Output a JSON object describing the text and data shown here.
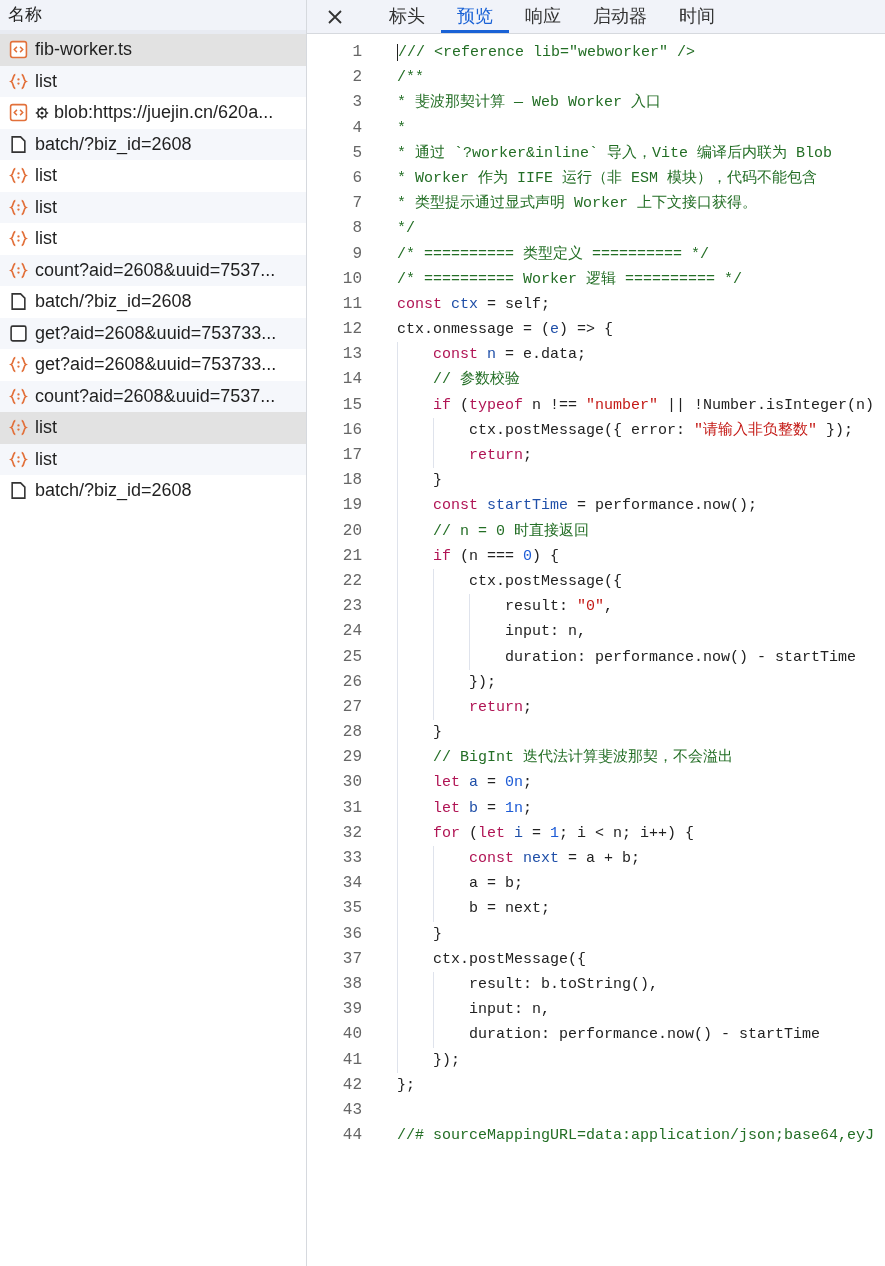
{
  "requests": {
    "header": "名称",
    "rows": [
      {
        "kind": "script",
        "name": "fib-worker.ts",
        "selected": true,
        "hovered": false
      },
      {
        "kind": "fetch",
        "name": "list",
        "selected": false,
        "hovered": false
      },
      {
        "kind": "script",
        "worker": true,
        "name": "blob:https://juejin.cn/620a...",
        "selected": false,
        "hovered": false
      },
      {
        "kind": "document",
        "name": "batch/?biz_id=2608",
        "selected": false,
        "hovered": false
      },
      {
        "kind": "fetch",
        "name": "list",
        "selected": false,
        "hovered": false
      },
      {
        "kind": "fetch",
        "name": "list",
        "selected": false,
        "hovered": false
      },
      {
        "kind": "fetch",
        "name": "list",
        "selected": false,
        "hovered": false
      },
      {
        "kind": "fetch",
        "name": "count?aid=2608&uuid=7537...",
        "selected": false,
        "hovered": false
      },
      {
        "kind": "document",
        "name": "batch/?biz_id=2608",
        "selected": false,
        "hovered": false
      },
      {
        "kind": "other",
        "name": "get?aid=2608&uuid=753733...",
        "selected": false,
        "hovered": false
      },
      {
        "kind": "fetch",
        "name": "get?aid=2608&uuid=753733...",
        "selected": false,
        "hovered": false
      },
      {
        "kind": "fetch",
        "name": "count?aid=2608&uuid=7537...",
        "selected": false,
        "hovered": false
      },
      {
        "kind": "fetch",
        "name": "list",
        "selected": true,
        "hovered": false
      },
      {
        "kind": "fetch",
        "name": "list",
        "selected": false,
        "hovered": false
      },
      {
        "kind": "document",
        "name": "batch/?biz_id=2608",
        "selected": false,
        "hovered": false
      }
    ]
  },
  "tabs": [
    {
      "label": "标头",
      "selected": false
    },
    {
      "label": "预览",
      "selected": true
    },
    {
      "label": "响应",
      "selected": false
    },
    {
      "label": "启动器",
      "selected": false
    },
    {
      "label": "时间",
      "selected": false
    }
  ],
  "code": [
    {
      "number": "1",
      "tokens": [
        {
          "kind": "comment",
          "text": "/// <reference lib=\"webworker\" />"
        }
      ]
    },
    {
      "number": "2",
      "tokens": [
        {
          "kind": "comment",
          "text": "/**"
        }
      ]
    },
    {
      "number": "3",
      "tokens": [
        {
          "kind": "comment",
          "text": "* 斐波那契计算 — Web Worker 入口"
        }
      ]
    },
    {
      "number": "4",
      "tokens": [
        {
          "kind": "comment",
          "text": "*"
        }
      ]
    },
    {
      "number": "5",
      "tokens": [
        {
          "kind": "comment",
          "text": "* 通过 `?worker&inline` 导入，Vite 编译后内联为 Blob"
        }
      ]
    },
    {
      "number": "6",
      "tokens": [
        {
          "kind": "comment",
          "text": "* Worker 作为 IIFE 运行（非 ESM 模块），代码不能包含"
        }
      ]
    },
    {
      "number": "7",
      "tokens": [
        {
          "kind": "comment",
          "text": "* 类型提示通过显式声明 Worker 上下文接口获得。"
        }
      ]
    },
    {
      "number": "8",
      "tokens": [
        {
          "kind": "comment",
          "text": "*/"
        }
      ]
    },
    {
      "number": "9",
      "tokens": [
        {
          "kind": "comment",
          "text": "/* ========== 类型定义 ========== */"
        }
      ]
    },
    {
      "number": "10",
      "tokens": [
        {
          "kind": "comment",
          "text": "/* ========== Worker 逻辑 ========== */"
        }
      ]
    },
    {
      "number": "11",
      "tokens": [
        {
          "kind": "keyword",
          "text": "const"
        },
        {
          "kind": "variable",
          "text": " ctx"
        },
        {
          "kind": "plain",
          "text": " = self;"
        }
      ]
    },
    {
      "number": "12",
      "tokens": [
        {
          "kind": "plain",
          "text": "ctx.onmessage = ("
        },
        {
          "kind": "variable",
          "text": "e"
        },
        {
          "kind": "plain",
          "text": ") => {"
        }
      ]
    },
    {
      "number": "13",
      "tokens": [
        {
          "kind": "keyword",
          "text": "    const"
        },
        {
          "kind": "variable",
          "text": " n"
        },
        {
          "kind": "plain",
          "text": " = e.data;"
        }
      ]
    },
    {
      "number": "14",
      "tokens": [
        {
          "kind": "comment",
          "text": "    // 参数校验"
        }
      ]
    },
    {
      "number": "15",
      "tokens": [
        {
          "kind": "keyword",
          "text": "    if"
        },
        {
          "kind": "plain",
          "text": " ("
        },
        {
          "kind": "keyword",
          "text": "typeof"
        },
        {
          "kind": "plain",
          "text": " n !== "
        },
        {
          "kind": "string",
          "text": "\"number\""
        },
        {
          "kind": "plain",
          "text": " || !Number.isInteger(n)"
        }
      ]
    },
    {
      "number": "16",
      "tokens": [
        {
          "kind": "plain",
          "text": "        ctx.postMessage({ error: "
        },
        {
          "kind": "string",
          "text": "\"请输入非负整数\""
        },
        {
          "kind": "plain",
          "text": " });"
        }
      ]
    },
    {
      "number": "17",
      "tokens": [
        {
          "kind": "keyword",
          "text": "        return"
        },
        {
          "kind": "plain",
          "text": ";"
        }
      ]
    },
    {
      "number": "18",
      "tokens": [
        {
          "kind": "plain",
          "text": "    }"
        }
      ]
    },
    {
      "number": "19",
      "tokens": [
        {
          "kind": "keyword",
          "text": "    const"
        },
        {
          "kind": "variable",
          "text": " startTime"
        },
        {
          "kind": "plain",
          "text": " = performance.now();"
        }
      ]
    },
    {
      "number": "20",
      "tokens": [
        {
          "kind": "comment",
          "text": "    // n = 0 时直接返回"
        }
      ]
    },
    {
      "number": "21",
      "tokens": [
        {
          "kind": "keyword",
          "text": "    if"
        },
        {
          "kind": "plain",
          "text": " (n === "
        },
        {
          "kind": "number",
          "text": "0"
        },
        {
          "kind": "plain",
          "text": ") {"
        }
      ]
    },
    {
      "number": "22",
      "tokens": [
        {
          "kind": "plain",
          "text": "        ctx.postMessage({"
        }
      ]
    },
    {
      "number": "23",
      "tokens": [
        {
          "kind": "plain",
          "text": "            result: "
        },
        {
          "kind": "string",
          "text": "\"0\""
        },
        {
          "kind": "plain",
          "text": ","
        }
      ]
    },
    {
      "number": "24",
      "tokens": [
        {
          "kind": "plain",
          "text": "            input: n,"
        }
      ]
    },
    {
      "number": "25",
      "tokens": [
        {
          "kind": "plain",
          "text": "            duration: performance.now() - startTime"
        }
      ]
    },
    {
      "number": "26",
      "tokens": [
        {
          "kind": "plain",
          "text": "        });"
        }
      ]
    },
    {
      "number": "27",
      "tokens": [
        {
          "kind": "keyword",
          "text": "        return"
        },
        {
          "kind": "plain",
          "text": ";"
        }
      ]
    },
    {
      "number": "28",
      "tokens": [
        {
          "kind": "plain",
          "text": "    }"
        }
      ]
    },
    {
      "number": "29",
      "tokens": [
        {
          "kind": "comment",
          "text": "    // BigInt 迭代法计算斐波那契，不会溢出"
        }
      ]
    },
    {
      "number": "30",
      "tokens": [
        {
          "kind": "keyword",
          "text": "    let"
        },
        {
          "kind": "variable",
          "text": " a"
        },
        {
          "kind": "plain",
          "text": " = "
        },
        {
          "kind": "number",
          "text": "0n"
        },
        {
          "kind": "plain",
          "text": ";"
        }
      ]
    },
    {
      "number": "31",
      "tokens": [
        {
          "kind": "keyword",
          "text": "    let"
        },
        {
          "kind": "variable",
          "text": " b"
        },
        {
          "kind": "plain",
          "text": " = "
        },
        {
          "kind": "number",
          "text": "1n"
        },
        {
          "kind": "plain",
          "text": ";"
        }
      ]
    },
    {
      "number": "32",
      "tokens": [
        {
          "kind": "keyword",
          "text": "    for"
        },
        {
          "kind": "plain",
          "text": " ("
        },
        {
          "kind": "keyword",
          "text": "let"
        },
        {
          "kind": "variable",
          "text": " i"
        },
        {
          "kind": "plain",
          "text": " = "
        },
        {
          "kind": "number",
          "text": "1"
        },
        {
          "kind": "plain",
          "text": "; i < n; i++) {"
        }
      ]
    },
    {
      "number": "33",
      "tokens": [
        {
          "kind": "keyword",
          "text": "        const"
        },
        {
          "kind": "variable",
          "text": " next"
        },
        {
          "kind": "plain",
          "text": " = a + b;"
        }
      ]
    },
    {
      "number": "34",
      "tokens": [
        {
          "kind": "plain",
          "text": "        a = b;"
        }
      ]
    },
    {
      "number": "35",
      "tokens": [
        {
          "kind": "plain",
          "text": "        b = next;"
        }
      ]
    },
    {
      "number": "36",
      "tokens": [
        {
          "kind": "plain",
          "text": "    }"
        }
      ]
    },
    {
      "number": "37",
      "tokens": [
        {
          "kind": "plain",
          "text": "    ctx.postMessage({"
        }
      ]
    },
    {
      "number": "38",
      "tokens": [
        {
          "kind": "plain",
          "text": "        result: b.toString(),"
        }
      ]
    },
    {
      "number": "39",
      "tokens": [
        {
          "kind": "plain",
          "text": "        input: n,"
        }
      ]
    },
    {
      "number": "40",
      "tokens": [
        {
          "kind": "plain",
          "text": "        duration: performance.now() - startTime"
        }
      ]
    },
    {
      "number": "41",
      "tokens": [
        {
          "kind": "plain",
          "text": "    });"
        }
      ]
    },
    {
      "number": "42",
      "tokens": [
        {
          "kind": "plain",
          "text": "};"
        }
      ]
    },
    {
      "number": "43"
    },
    {
      "number": "44",
      "tokens": [
        {
          "kind": "comment",
          "text": "//# sourceMappingURL=data:application/json;base64,eyJ"
        }
      ]
    }
  ]
}
